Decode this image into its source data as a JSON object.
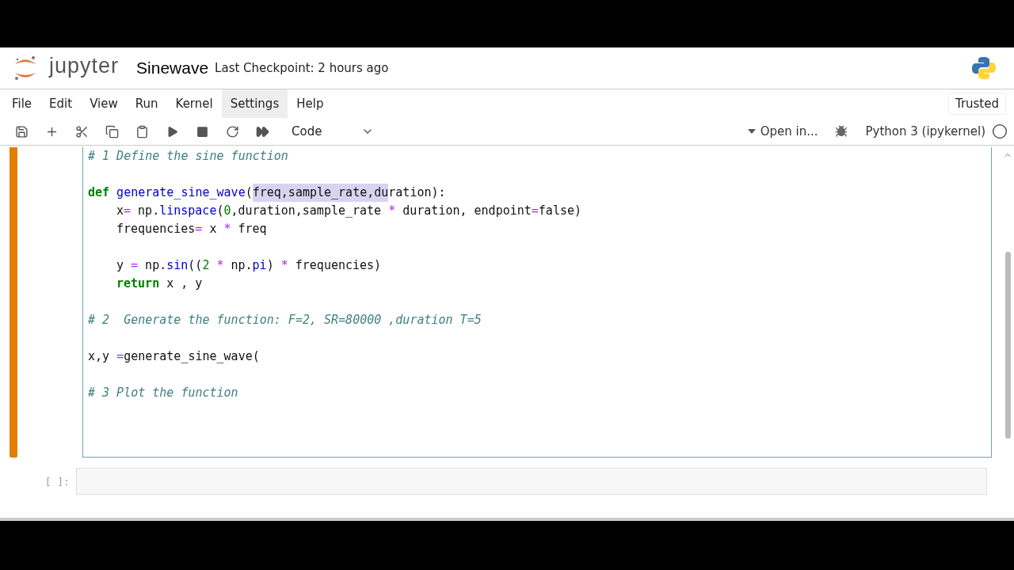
{
  "header": {
    "logo_text": "jupyter",
    "notebook_title": "Sinewave",
    "checkpoint": "Last Checkpoint: 2 hours ago"
  },
  "menu": [
    {
      "label": "File",
      "selected": false
    },
    {
      "label": "Edit",
      "selected": false
    },
    {
      "label": "View",
      "selected": false
    },
    {
      "label": "Run",
      "selected": false
    },
    {
      "label": "Kernel",
      "selected": false
    },
    {
      "label": "Settings",
      "selected": true
    },
    {
      "label": "Help",
      "selected": false
    }
  ],
  "trusted": "Trusted",
  "toolbar": {
    "cell_type": "Code",
    "open_in": "Open in...",
    "kernel": "Python 3 (ipykernel)"
  },
  "cell": {
    "blocks": [
      {
        "lines": [
          {
            "tokens": [
              {
                "kind": "comment",
                "text": "# 1 Define the sine function"
              }
            ]
          }
        ]
      },
      {
        "lines": [
          {
            "tokens": [
              {
                "kind": "keyword",
                "text": "def"
              },
              {
                "kind": "function",
                "text": " generate_sine_wave"
              },
              {
                "kind": "plain",
                "text": "("
              },
              {
                "kind": "selected",
                "text": "freq,sample_rate,du"
              },
              {
                "kind": "plain",
                "text": "ration):"
              }
            ],
            "children": [
              {
                "lines": [
                  {
                    "tokens": [
                      {
                        "kind": "plain",
                        "text": "x"
                      },
                      {
                        "kind": "operator",
                        "text": "="
                      },
                      {
                        "kind": "plain",
                        "text": " np."
                      },
                      {
                        "kind": "function",
                        "text": "linspace"
                      },
                      {
                        "kind": "plain",
                        "text": "("
                      },
                      {
                        "kind": "number",
                        "text": "0"
                      },
                      {
                        "kind": "plain",
                        "text": ",duration,sample_rate "
                      },
                      {
                        "kind": "operator",
                        "text": "*"
                      },
                      {
                        "kind": "plain",
                        "text": " duration, endpoint"
                      },
                      {
                        "kind": "operator",
                        "text": "="
                      },
                      {
                        "kind": "plain",
                        "text": "false)"
                      }
                    ]
                  },
                  {
                    "tokens": [
                      {
                        "kind": "plain",
                        "text": "frequencies"
                      },
                      {
                        "kind": "operator",
                        "text": "="
                      },
                      {
                        "kind": "plain",
                        "text": " x "
                      },
                      {
                        "kind": "operator",
                        "text": "*"
                      },
                      {
                        "kind": "plain",
                        "text": " freq"
                      }
                    ]
                  }
                ]
              },
              {
                "lines": [
                  {
                    "tokens": [
                      {
                        "kind": "plain",
                        "text": "y "
                      },
                      {
                        "kind": "operator",
                        "text": "="
                      },
                      {
                        "kind": "plain",
                        "text": " np."
                      },
                      {
                        "kind": "function",
                        "text": "sin"
                      },
                      {
                        "kind": "plain",
                        "text": "(("
                      },
                      {
                        "kind": "number",
                        "text": "2"
                      },
                      {
                        "kind": "operator",
                        "text": " *"
                      },
                      {
                        "kind": "plain",
                        "text": " np."
                      },
                      {
                        "kind": "function",
                        "text": "pi"
                      },
                      {
                        "kind": "plain",
                        "text": ") "
                      },
                      {
                        "kind": "operator",
                        "text": "*"
                      },
                      {
                        "kind": "plain",
                        "text": " frequencies)"
                      }
                    ]
                  },
                  {
                    "tokens": [
                      {
                        "kind": "keyword",
                        "text": "return"
                      },
                      {
                        "kind": "plain",
                        "text": " x , y"
                      }
                    ]
                  }
                ]
              }
            ]
          }
        ]
      },
      {
        "lines": [
          {
            "tokens": [
              {
                "kind": "comment",
                "text": "# 2  Generate the function: F=2, SR=80000 ,duration T=5"
              }
            ]
          }
        ]
      },
      {
        "lines": [
          {
            "tokens": [
              {
                "kind": "plain",
                "text": "x,y "
              },
              {
                "kind": "operator",
                "text": "="
              },
              {
                "kind": "plain",
                "text": "generate_sine_wave("
              }
            ]
          }
        ]
      },
      {
        "lines": [
          {
            "tokens": [
              {
                "kind": "comment",
                "text": "# 3 Plot the function"
              }
            ]
          }
        ]
      }
    ]
  },
  "empty_cell": {
    "prompt": "[ ]:"
  }
}
